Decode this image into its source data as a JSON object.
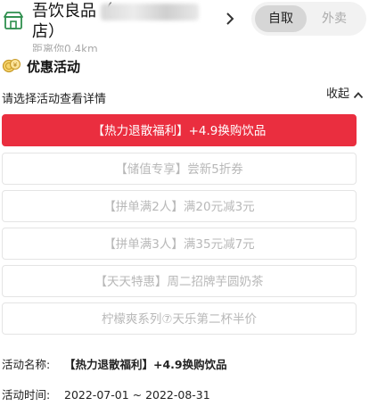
{
  "store": {
    "name": "吾饮良品（",
    "name_line2": "店）",
    "distance": "距离你0.4km"
  },
  "mode_toggle": {
    "options": [
      "自取",
      "外卖"
    ],
    "selected": "自取"
  },
  "promotions_section": {
    "title": "优惠活动",
    "hint": "请选择活动查看详情",
    "collapse_label": "收起",
    "items": [
      {
        "label": "【热力退散福利】+4.9换购饮品",
        "active": true
      },
      {
        "label": "【储值专享】尝新5折券",
        "active": false
      },
      {
        "label": "【拼单满2人】满20元减3元",
        "active": false
      },
      {
        "label": "【拼单满3人】满35元减7元",
        "active": false
      },
      {
        "label": "【天天特惠】周二招牌芋圆奶茶",
        "active": false
      },
      {
        "label": "柠檬爽系列⑦天乐第二杯半价",
        "active": false
      }
    ]
  },
  "detail": {
    "name_label": "活动名称:",
    "name_value": "【热力退散福利】+4.9换购饮品",
    "time_label": "活动时间:",
    "time_value": "2022-07-01 ~ 2022-08-31"
  },
  "colors": {
    "accent": "#ea2e3f",
    "inactive_text": "#b8b8b8",
    "border": "#e4e4e4"
  },
  "icons": {
    "store": "store-icon",
    "section": "coin-icon",
    "nav": "chevron-right-icon",
    "collapse": "chevron-up-icon"
  }
}
